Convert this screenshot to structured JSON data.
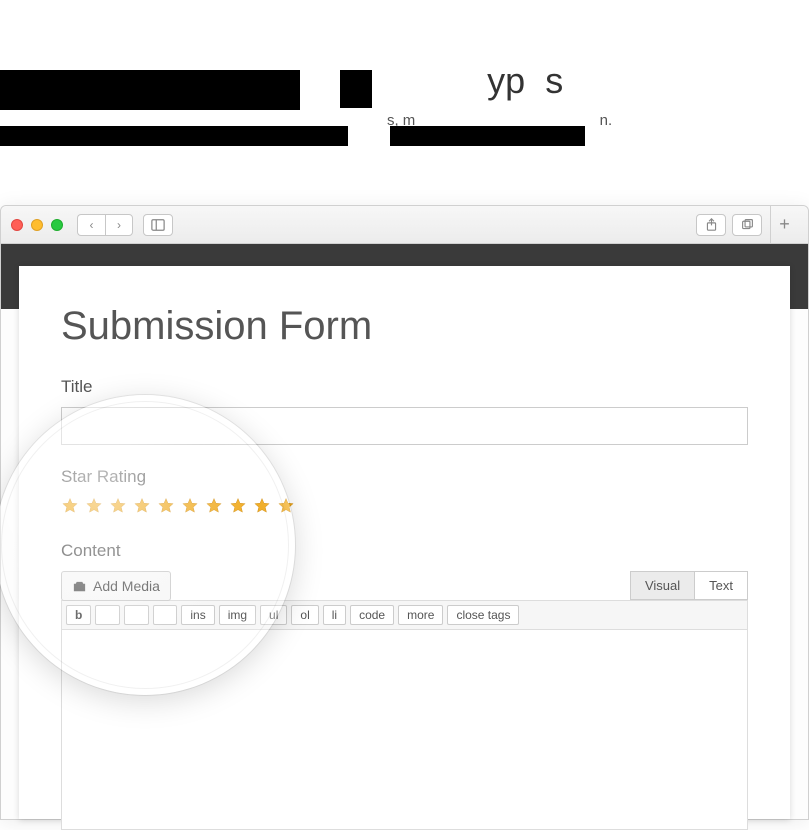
{
  "header": {
    "title_fragment1": "yp",
    "title_fragment2": "s",
    "sub_fragment1": "s, m",
    "sub_fragment2": "n."
  },
  "browser": {
    "back": "‹",
    "forward": "›",
    "plus": "+"
  },
  "form": {
    "heading": "Submission Form",
    "title_label": "Title",
    "title_value": "",
    "rating_label": "Star Rating",
    "star_count": 10,
    "star_color": "#f0a818",
    "content_label": "Content",
    "add_media": "Add Media",
    "tabs": {
      "visual": "Visual",
      "text": "Text",
      "active": "visual"
    },
    "toolbar": [
      "b",
      "",
      "",
      "",
      "ins",
      "img",
      "ul",
      "ol",
      "li",
      "code",
      "more",
      "close tags"
    ]
  }
}
